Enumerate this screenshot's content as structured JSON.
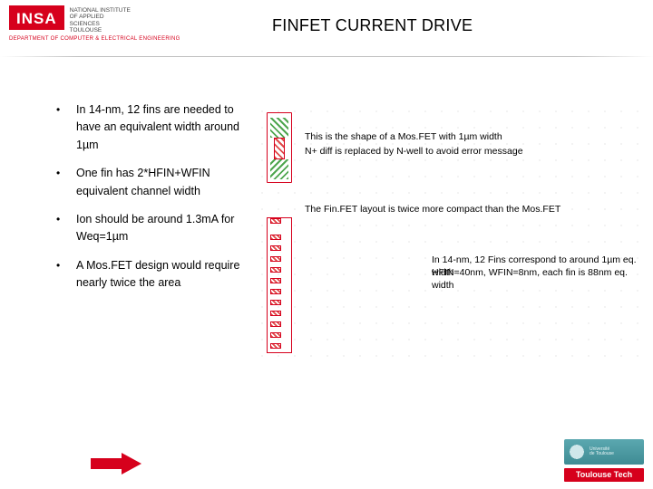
{
  "colors": {
    "accent": "#d6001c",
    "teal": "#3e8b94"
  },
  "header": {
    "logo_text": "INSA",
    "institute_lines": "NATIONAL INSTITUTE\nOF APPLIED\nSCIENCES\nTOULOUSE",
    "department": "DEPARTMENT OF COMPUTER & ELECTRICAL ENGINEERING",
    "title": "FINFET CURRENT DRIVE"
  },
  "bullets": [
    "In 14-nm, 12 fins are needed to have an equivalent width around 1µm",
    "One fin has 2*HFIN+WFIN equivalent channel width",
    "Ion should be around 1.3mA for Weq=1µm",
    "A Mos.FET design would require nearly twice the area"
  ],
  "diagram": {
    "note1a": "This is the shape of a Mos.FET with 1µm width",
    "note1b": "N+ diff is replaced by N-well to avoid error message",
    "note2": "The Fin.FET layout is twice more compact than the Mos.FET",
    "note3a": "In 14-nm, 12 Fins correspond to around 1µm eq. width",
    "note3b": "HFIN=40nm, WFIN=8nm, each fin is 88nm eq. width"
  },
  "footer": {
    "ups_label": "Université\nde Toulouse",
    "tt_label": "Toulouse Tech"
  }
}
